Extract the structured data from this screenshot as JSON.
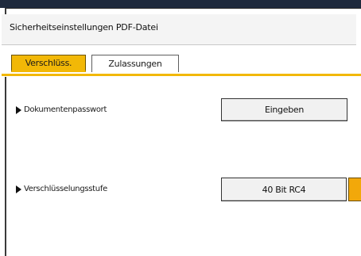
{
  "dialog": {
    "title": "Sicherheitseinstellungen PDF-Datei"
  },
  "tabs": [
    {
      "label": "Verschlüss.",
      "active": true
    },
    {
      "label": "Zulassungen",
      "active": false
    }
  ],
  "rows": [
    {
      "label": "Dokumentenpasswort",
      "button": "Eingeben"
    },
    {
      "label": "Verschlüsselungsstufe",
      "button": "40 Bit RC4"
    }
  ],
  "colors": {
    "accent": "#f2b807",
    "orange_button": "#f2a80a"
  }
}
